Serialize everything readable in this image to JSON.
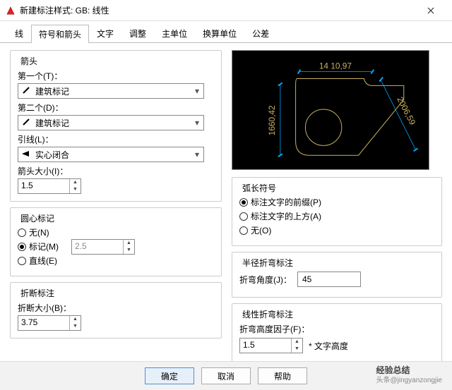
{
  "window": {
    "title": "新建标注样式: GB: 线性"
  },
  "tabs": [
    "线",
    "符号和箭头",
    "文字",
    "调整",
    "主单位",
    "换算单位",
    "公差"
  ],
  "active_tab": 1,
  "arrows": {
    "legend": "箭头",
    "first_label": "第一个(T)：",
    "first_value": "建筑标记",
    "second_label": "第二个(D)：",
    "second_value": "建筑标记",
    "leader_label": "引线(L)：",
    "leader_value": "实心闭合",
    "size_label": "箭头大小(I)：",
    "size_value": "1.5"
  },
  "center_mark": {
    "legend": "圆心标记",
    "opt_none": "无(N)",
    "opt_mark": "标记(M)",
    "opt_line": "直线(E)",
    "selected": "mark",
    "size_value": "2.5"
  },
  "break_dim": {
    "legend": "折断标注",
    "size_label": "折断大小(B)：",
    "size_value": "3.75"
  },
  "arc_symbol": {
    "legend": "弧长符号",
    "opt_before": "标注文字的前缀(P)",
    "opt_above": "标注文字的上方(A)",
    "opt_none": "无(O)",
    "selected": "before"
  },
  "radius_jog": {
    "legend": "半径折弯标注",
    "angle_label": "折弯角度(J)：",
    "angle_value": "45"
  },
  "linear_jog": {
    "legend": "线性折弯标注",
    "factor_label": "折弯高度因子(F)：",
    "factor_value": "1.5",
    "note": "* 文字高度"
  },
  "preview": {
    "dim_top": "14 10,97",
    "dim_left": "1660,42",
    "dim_right": "2006,59"
  },
  "buttons": {
    "ok": "确定",
    "cancel": "取消",
    "help": "帮助"
  },
  "watermark": {
    "big": "经验总结",
    "small": "头条@jingyanzongjie"
  }
}
